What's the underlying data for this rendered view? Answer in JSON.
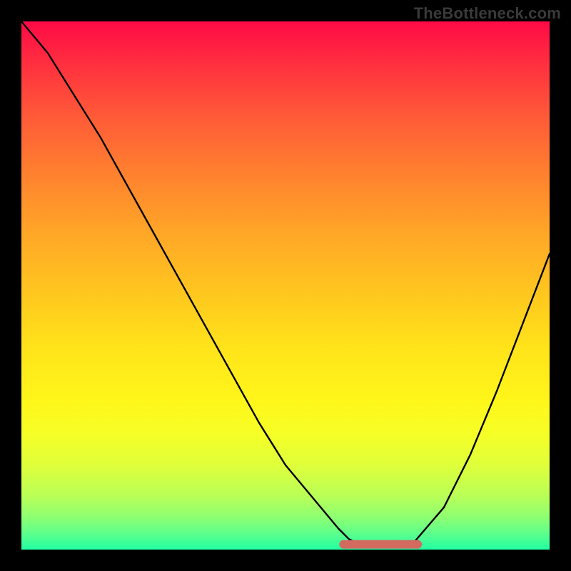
{
  "watermark": "TheBottleneck.com",
  "chart_data": {
    "type": "line",
    "title": "",
    "xlabel": "",
    "ylabel": "",
    "x_range": [
      0,
      100
    ],
    "y_range": [
      0,
      100
    ],
    "grid": false,
    "legend": false,
    "series": [
      {
        "name": "bottleneck-curve",
        "x": [
          0,
          5,
          10,
          15,
          20,
          25,
          30,
          35,
          40,
          45,
          50,
          55,
          60,
          62,
          64,
          70,
          74,
          80,
          85,
          90,
          95,
          100
        ],
        "y": [
          100,
          94,
          86,
          78,
          69,
          60,
          51,
          42,
          33,
          24,
          16,
          10,
          4,
          2,
          1,
          1,
          1,
          8,
          18,
          30,
          43,
          56
        ]
      }
    ],
    "highlight_segment": {
      "name": "optimal-flat-region",
      "x_start": 61,
      "x_end": 75,
      "y": 1,
      "color": "#d36a60"
    },
    "background_gradient": {
      "stops": [
        {
          "pos": 0,
          "color": "#ff0a46"
        },
        {
          "pos": 18,
          "color": "#ff5a38"
        },
        {
          "pos": 40,
          "color": "#ffa627"
        },
        {
          "pos": 62,
          "color": "#ffe41a"
        },
        {
          "pos": 84,
          "color": "#dfff3a"
        },
        {
          "pos": 100,
          "color": "#22ffa3"
        }
      ]
    }
  }
}
